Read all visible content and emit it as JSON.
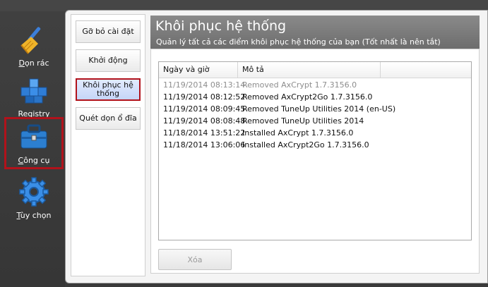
{
  "sidebar": {
    "items": [
      {
        "label_pre": "",
        "label_u": "D",
        "label_post": "ọn rác",
        "icon": "broom-icon"
      },
      {
        "label_pre": "",
        "label_u": "R",
        "label_post": "egistry",
        "icon": "registry-cubes-icon"
      },
      {
        "label_pre": "",
        "label_u": "C",
        "label_post": "ông cụ",
        "icon": "toolbox-icon",
        "selected": true
      },
      {
        "label_pre": "",
        "label_u": "T",
        "label_post": "ùy chọn",
        "icon": "gear-icon"
      }
    ]
  },
  "subnav": {
    "items": [
      {
        "label": "Gỡ bỏ cài đặt"
      },
      {
        "label": "Khởi động"
      },
      {
        "label": "Khôi phục hệ thống",
        "active": true
      },
      {
        "label": "Quét dọn ổ đĩa"
      }
    ]
  },
  "header": {
    "title": "Khôi phục hệ thống",
    "subtitle": "Quản lý tất cả các điểm khôi phục hệ thống của bạn (Tốt nhất là nên tắt)"
  },
  "table": {
    "columns": [
      "Ngày và giờ",
      "Mô tả"
    ],
    "rows": [
      {
        "datetime": "11/19/2014 08:13:14",
        "description": "Removed AxCrypt 1.7.3156.0",
        "dim": true
      },
      {
        "datetime": "11/19/2014 08:12:52",
        "description": "Removed AxCrypt2Go 1.7.3156.0"
      },
      {
        "datetime": "11/19/2014 08:09:45",
        "description": "Removed TuneUp Utilities 2014 (en-US)"
      },
      {
        "datetime": "11/19/2014 08:08:48",
        "description": "Removed TuneUp Utilities 2014"
      },
      {
        "datetime": "11/18/2014 13:51:22",
        "description": "Installed AxCrypt 1.7.3156.0"
      },
      {
        "datetime": "11/18/2014 13:06:06",
        "description": "Installed AxCrypt2Go 1.7.3156.0"
      }
    ]
  },
  "actions": {
    "delete_label": "Xóa",
    "delete_enabled": false
  },
  "colors": {
    "selection_outline": "#b1121b",
    "header_bg": "#7a7a7a",
    "sidebar_bg": "#3a3a3a",
    "active_tab_bg": "#c5d5f7"
  }
}
